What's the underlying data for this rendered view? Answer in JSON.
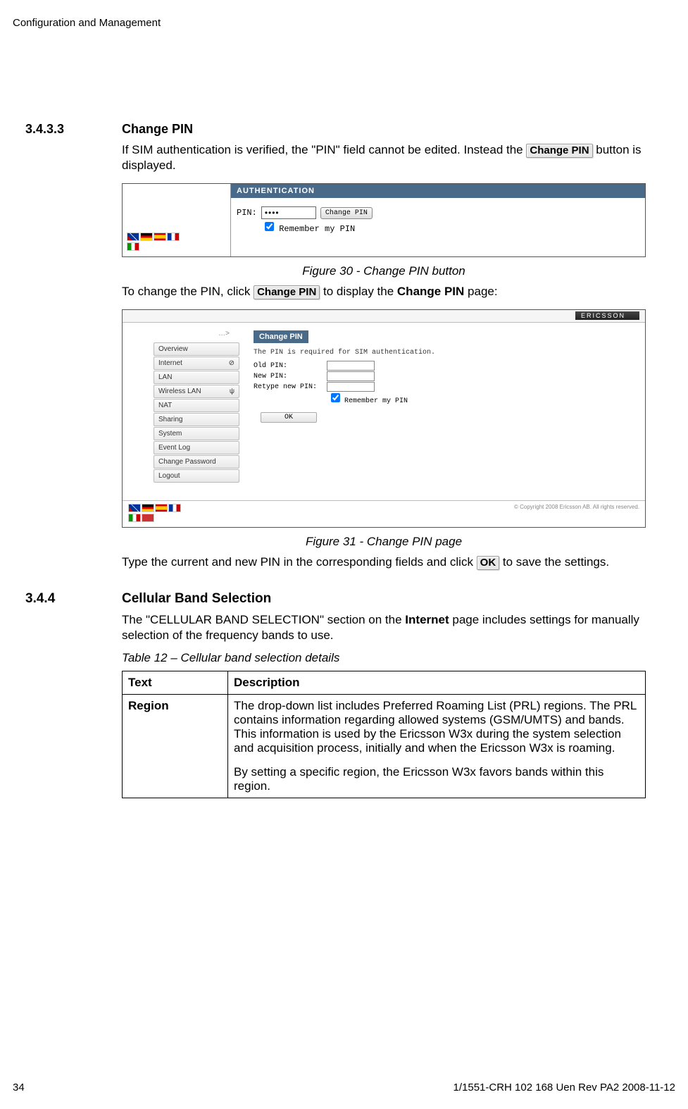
{
  "header": "Configuration and Management",
  "section1": {
    "number": "3.4.3.3",
    "title": "Change PIN",
    "para1_a": "If SIM authentication is verified, the \"PIN\" field cannot be edited. Instead the ",
    "btn_change_pin": "Change PIN",
    "para1_b": " button is displayed.",
    "fig30": {
      "auth_title": "AUTHENTICATION",
      "pin_label": "PIN:",
      "pin_value": "••••",
      "change_pin_btn": "Change PIN",
      "remember": "Remember my PIN",
      "caption": "Figure 30 - Change PIN button"
    },
    "para2_a": "To change the PIN, click ",
    "para2_b": " to display the ",
    "para2_strong": "Change PIN",
    "para2_c": " page:",
    "fig31": {
      "brand": "ERICSSON",
      "breadcrumb": "…>",
      "title": "Change PIN",
      "desc": "The PIN is required for SIM authentication.",
      "old_pin": "Old PIN:",
      "new_pin": "New PIN:",
      "retype": "Retype new PIN:",
      "remember": "Remember my PIN",
      "ok": "OK",
      "nav": [
        "Overview",
        "Internet",
        "LAN",
        "Wireless LAN",
        "NAT",
        "Sharing",
        "System",
        "Event Log",
        "Change Password",
        "Logout"
      ],
      "copyright": "© Copyright 2008 Ericsson AB. All rights reserved.",
      "caption": "Figure 31 - Change PIN page"
    },
    "para3_a": "Type the current and new PIN in the corresponding fields and click ",
    "btn_ok": "OK",
    "para3_b": " to save the settings."
  },
  "section2": {
    "number": "3.4.4",
    "title": "Cellular Band Selection",
    "para1_a": "The \"CELLULAR BAND SELECTION\" section on the ",
    "para1_strong": "Internet",
    "para1_b": " page includes settings for manually selection of the frequency bands to use.",
    "table_caption": "Table 12 – Cellular band selection details",
    "table": {
      "header_text": "Text",
      "header_desc": "Description",
      "row1_text": "Region",
      "row1_desc_p1": "The drop-down list includes Preferred Roaming List (PRL) regions. The PRL contains information regarding allowed systems (GSM/UMTS) and bands. This information is used by the Ericsson W3x during the system selection and acquisition process, initially and when the Ericsson W3x is roaming.",
      "row1_desc_p2": "By setting a specific region, the Ericsson W3x favors bands within this region."
    }
  },
  "footer": {
    "page": "34",
    "docid": "1/1551-CRH 102 168 Uen Rev PA2  2008-11-12"
  }
}
